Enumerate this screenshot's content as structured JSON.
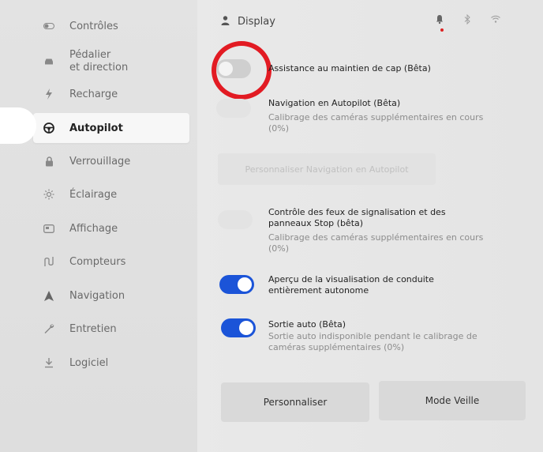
{
  "sidebar": {
    "items": [
      {
        "label": "Contrôles",
        "icon": "toggle-icon"
      },
      {
        "label": "Pédalier",
        "label2": "et direction",
        "icon": "car-icon"
      },
      {
        "label": "Recharge",
        "icon": "bolt-icon"
      },
      {
        "label": "Autopilot",
        "icon": "steering-wheel-icon",
        "active": true
      },
      {
        "label": "Verrouillage",
        "icon": "lock-icon"
      },
      {
        "label": "Éclairage",
        "icon": "sun-icon"
      },
      {
        "label": "Affichage",
        "icon": "display-icon"
      },
      {
        "label": "Compteurs",
        "icon": "road-icon"
      },
      {
        "label": "Navigation",
        "icon": "navigation-icon"
      },
      {
        "label": "Entretien",
        "icon": "wrench-icon"
      },
      {
        "label": "Logiciel",
        "icon": "download-icon"
      }
    ]
  },
  "header": {
    "profile_label": "Display"
  },
  "settings": {
    "autosteer": {
      "title": "Assistance au maintien de cap (Bêta)",
      "state": "off"
    },
    "nav_autopilot": {
      "title": "Navigation en Autopilot (Bêta)",
      "subtitle": "Calibrage des caméras supplémentaires en cours (0%)",
      "state": "disabled"
    },
    "customize_nav_label": "Personnaliser Navigation en Autopilot",
    "traffic_control": {
      "title": "Contrôle des feux de signalisation et des panneaux Stop (bêta)",
      "subtitle": "Calibrage des caméras supplémentaires en cours (0%)",
      "state": "disabled"
    },
    "fsd_preview": {
      "title": "Aperçu de la visualisation de conduite entièrement autonome",
      "state": "on"
    },
    "auto_exit": {
      "title": "Sortie auto (Bêta)",
      "subtitle": "Sortie auto indisponible pendant le calibrage de caméras supplémentaires (0%)",
      "state": "on"
    }
  },
  "buttons": {
    "customize_label": "Personnaliser",
    "sleep_mode_label": "Mode Veille"
  },
  "colors": {
    "toggle_on": "#1b54d8",
    "highlight_circle": "#e21b23",
    "notification_dot": "#dd2222"
  }
}
